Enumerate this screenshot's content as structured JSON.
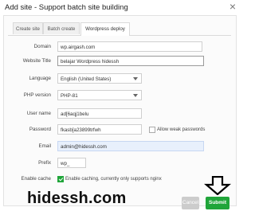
{
  "dialog": {
    "title": "Add site - Support batch site building",
    "close_glyph": "×"
  },
  "tabs": [
    {
      "label": "Create site"
    },
    {
      "label": "Batch create"
    },
    {
      "label": "Wordpress deploy",
      "active": true
    }
  ],
  "form": {
    "domain": {
      "label": "Domain",
      "value": "wp.airgash.com"
    },
    "website_title": {
      "label": "Website Title",
      "value": "belajar Wordpress hidessh"
    },
    "language": {
      "label": "Language",
      "value": "English (United States)"
    },
    "php_version": {
      "label": "PHP version",
      "value": "PHP-81"
    },
    "user_name": {
      "label": "User name",
      "value": "ad[6aqj1belu"
    },
    "password": {
      "label": "Password",
      "value": "fkasb[a23899trfwh",
      "weak_label": "Allow weak passwords",
      "weak_checked": false
    },
    "email": {
      "label": "Email",
      "value": "admin@hidessh.com"
    },
    "prefix": {
      "label": "Prefix",
      "value": "wp_"
    },
    "enable_cache": {
      "label": "Enable cache",
      "checked": true,
      "text": "Enable caching, currently only supports nginx"
    }
  },
  "watermark": "hidessh.com",
  "buttons": {
    "cancel": "Cancel",
    "submit": "Submit"
  },
  "colors": {
    "accent": "#20a53a",
    "arrow": "#000000"
  }
}
